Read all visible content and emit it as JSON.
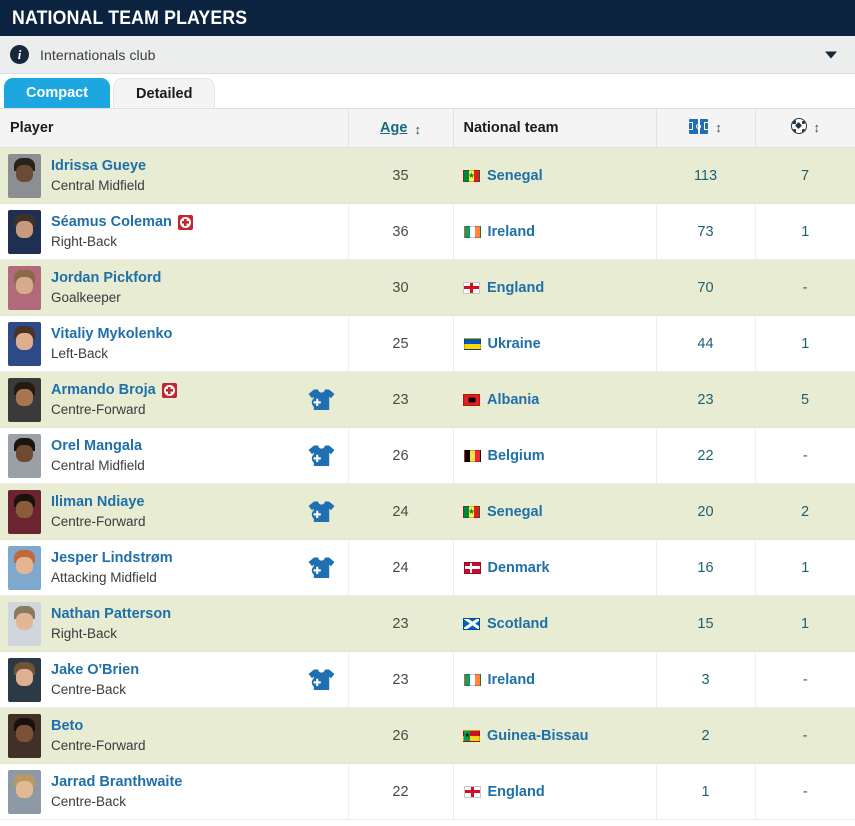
{
  "header": {
    "title": "NATIONAL TEAM PLAYERS",
    "info_label": "Internationals club",
    "info_icon": "info-icon",
    "caret_icon": "chevron-down-icon"
  },
  "tabs": [
    {
      "label": "Compact",
      "active": true
    },
    {
      "label": "Detailed",
      "active": false
    }
  ],
  "table": {
    "columns": {
      "player": "Player",
      "age": "Age",
      "national_team": "National team",
      "caps_icon": "football-pitch-icon",
      "goals_icon": "football-icon",
      "sort_arrow": "↕"
    },
    "rows": [
      {
        "name": "Idrissa Gueye",
        "position": "Central Midfield",
        "age": "35",
        "country": "Senegal",
        "flag": "fl-senegal",
        "caps": "113",
        "goals": "7",
        "injured": false,
        "new_signing": false,
        "avatar": {
          "hair": "#2a2118",
          "face": "#6b4b33",
          "body": "#8b8f94"
        }
      },
      {
        "name": "Séamus Coleman",
        "position": "Right-Back",
        "age": "36",
        "country": "Ireland",
        "flag": "fl-ireland",
        "caps": "73",
        "goals": "1",
        "injured": true,
        "new_signing": false,
        "avatar": {
          "hair": "#3d3228",
          "face": "#c79a7c",
          "body": "#1f2f52"
        }
      },
      {
        "name": "Jordan Pickford",
        "position": "Goalkeeper",
        "age": "30",
        "country": "England",
        "flag": "fl-england",
        "caps": "70",
        "goals": "-",
        "injured": false,
        "new_signing": false,
        "avatar": {
          "hair": "#8a6a45",
          "face": "#d8a98a",
          "body": "#b06a7a"
        }
      },
      {
        "name": "Vitaliy Mykolenko",
        "position": "Left-Back",
        "age": "25",
        "country": "Ukraine",
        "flag": "fl-ukraine",
        "caps": "44",
        "goals": "1",
        "injured": false,
        "new_signing": false,
        "avatar": {
          "hair": "#4a3524",
          "face": "#dfae8e",
          "body": "#2e4a86"
        }
      },
      {
        "name": "Armando Broja",
        "position": "Centre-Forward",
        "age": "23",
        "country": "Albania",
        "flag": "fl-albania",
        "caps": "23",
        "goals": "5",
        "injured": true,
        "new_signing": true,
        "avatar": {
          "hair": "#231a12",
          "face": "#a5764f",
          "body": "#3a3a3a"
        }
      },
      {
        "name": "Orel Mangala",
        "position": "Central Midfield",
        "age": "26",
        "country": "Belgium",
        "flag": "fl-belgium",
        "caps": "22",
        "goals": "-",
        "injured": false,
        "new_signing": true,
        "avatar": {
          "hair": "#1c150f",
          "face": "#6d4a30",
          "body": "#9aa0a6"
        }
      },
      {
        "name": "Iliman Ndiaye",
        "position": "Centre-Forward",
        "age": "24",
        "country": "Senegal",
        "flag": "fl-senegal",
        "caps": "20",
        "goals": "2",
        "injured": false,
        "new_signing": true,
        "avatar": {
          "hair": "#1a120c",
          "face": "#8a5c3a",
          "body": "#6b2430"
        }
      },
      {
        "name": "Jesper Lindstrøm",
        "position": "Attacking Midfield",
        "age": "24",
        "country": "Denmark",
        "flag": "fl-denmark",
        "caps": "16",
        "goals": "1",
        "injured": false,
        "new_signing": true,
        "avatar": {
          "hair": "#c0693a",
          "face": "#e3b593",
          "body": "#7fa8cf"
        }
      },
      {
        "name": "Nathan Patterson",
        "position": "Right-Back",
        "age": "23",
        "country": "Scotland",
        "flag": "fl-scotland",
        "caps": "15",
        "goals": "1",
        "injured": false,
        "new_signing": false,
        "avatar": {
          "hair": "#8c7a60",
          "face": "#e0b898",
          "body": "#cfd6dd"
        }
      },
      {
        "name": "Jake O'Brien",
        "position": "Centre-Back",
        "age": "23",
        "country": "Ireland",
        "flag": "fl-ireland",
        "caps": "3",
        "goals": "-",
        "injured": false,
        "new_signing": true,
        "avatar": {
          "hair": "#6e5437",
          "face": "#deb091",
          "body": "#2c3a46"
        }
      },
      {
        "name": "Beto",
        "position": "Centre-Forward",
        "age": "26",
        "country": "Guinea-Bissau",
        "flag": "fl-guinea-bissau",
        "caps": "2",
        "goals": "-",
        "injured": false,
        "new_signing": false,
        "avatar": {
          "hair": "#17110c",
          "face": "#7b5236",
          "body": "#403028"
        }
      },
      {
        "name": "Jarrad Branthwaite",
        "position": "Centre-Back",
        "age": "22",
        "country": "England",
        "flag": "fl-england",
        "caps": "1",
        "goals": "-",
        "injured": false,
        "new_signing": false,
        "avatar": {
          "hair": "#b79a63",
          "face": "#e2b895",
          "body": "#8d9aa6"
        }
      }
    ]
  },
  "colors": {
    "title_bar": "#0c2340",
    "tab_active": "#1ca7e0",
    "row_alt": "#e7ecd3",
    "link": "#1f6fa8",
    "injury": "#c3262c"
  }
}
